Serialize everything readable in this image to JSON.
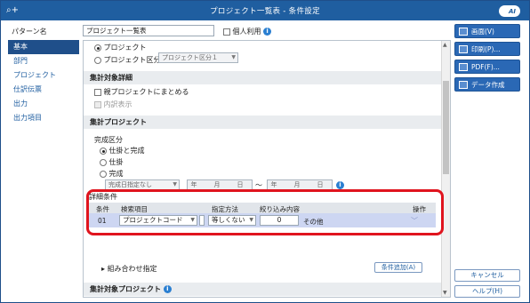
{
  "window": {
    "title": "プロジェクト一覧表 - 条件設定"
  },
  "pattern": {
    "label": "パターン名",
    "value": "プロジェクト一覧表",
    "personal_label": "個人利用"
  },
  "sidebar": {
    "items": [
      {
        "label": "基本",
        "active": true
      },
      {
        "label": "部門"
      },
      {
        "label": "プロジェクト"
      },
      {
        "label": "仕訳伝票"
      },
      {
        "label": "出力"
      },
      {
        "label": "出力項目"
      }
    ]
  },
  "main": {
    "radio_project": "プロジェクト",
    "radio_project_class": "プロジェクト区分",
    "project_class_select": "プロジェクト区分１",
    "section_target_detail": "集計対象詳細",
    "chk_summarize": "親プロジェクトにまとめる",
    "chk_breakdown": "内訳表示",
    "section_project": "集計プロジェクト",
    "completion_label": "完成区分",
    "completion_options": [
      "仕掛と完成",
      "仕掛",
      "完成"
    ],
    "completion_date_select": "完成日指定なし",
    "date_from": "年　月　日",
    "date_to": "年　月　日",
    "tilde": "～",
    "detail_title": "詳細条件",
    "detail_headers": {
      "cond": "条件",
      "item": "検索項目",
      "method": "指定方法",
      "content": "絞り込み内容",
      "action": "操作"
    },
    "detail_row": {
      "no": "01",
      "item": "プロジェクトコード",
      "method": "等しくない",
      "value": "0",
      "other": "その他"
    },
    "combo_label": "組み合わせ指定",
    "add_condition": "条件追加(A)",
    "section_target_project": "集計対象プロジェクト"
  },
  "right_buttons": {
    "screen": "画面(V)",
    "print": "印刷(P)...",
    "pdf": "PDF(F)...",
    "data": "データ作成(E)...",
    "cancel": "キャンセル",
    "help": "ヘルプ(H)"
  },
  "logo_text": "AI"
}
